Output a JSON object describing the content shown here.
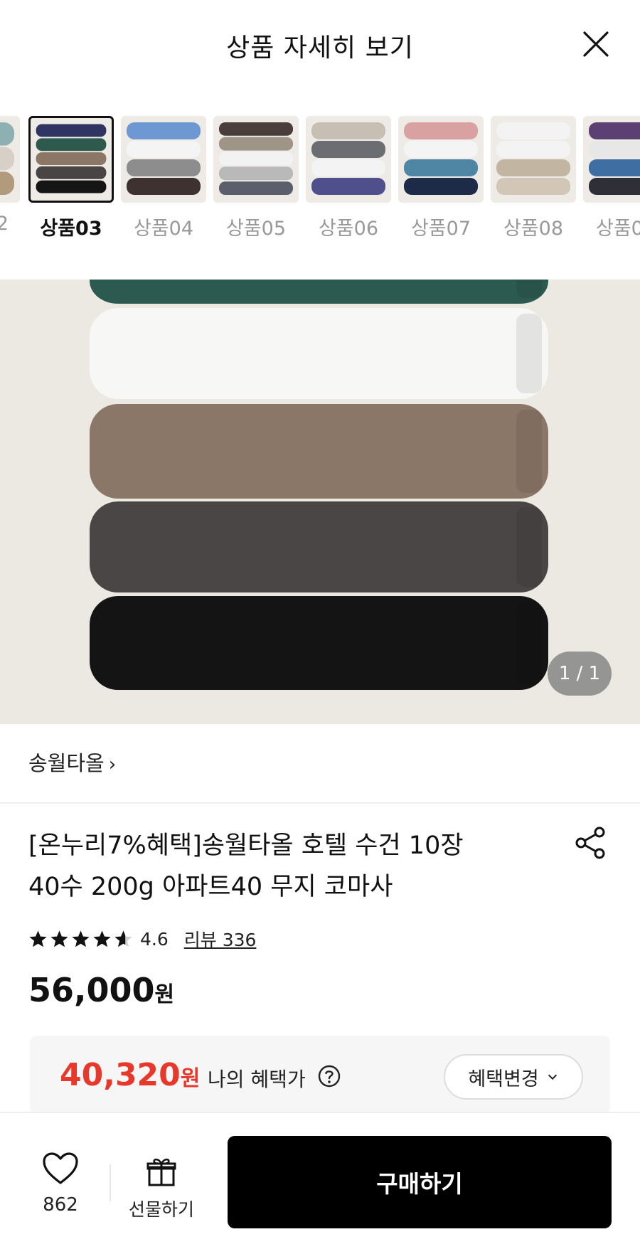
{
  "header": {
    "title": "상품 자세히 보기",
    "close_icon": "close-icon"
  },
  "thumbnails": [
    {
      "label": "2",
      "selected": false
    },
    {
      "label": "상품03",
      "selected": true,
      "colors": [
        "#2f3463",
        "#2e5a4d",
        "#8c7666",
        "#4a4545",
        "#151515"
      ]
    },
    {
      "label": "상품04",
      "selected": false,
      "colors": [
        "#6e98d2",
        "#f4f4f4",
        "#8d8d8d",
        "#3e3231"
      ]
    },
    {
      "label": "상품05",
      "selected": false,
      "colors": [
        "#4a3e3a",
        "#9e9488",
        "#f2f2f2",
        "#b9b9b9",
        "#5a5f6b"
      ]
    },
    {
      "label": "상품06",
      "selected": false,
      "colors": [
        "#c8bfb4",
        "#6c6d73",
        "#f3f3f3",
        "#4f4f8c"
      ]
    },
    {
      "label": "상품07",
      "selected": false,
      "colors": [
        "#d9a1a1",
        "#f4f4f4",
        "#4f86a3",
        "#1e2b48"
      ]
    },
    {
      "label": "상품08",
      "selected": false,
      "colors": [
        "#f3f3f3",
        "#f3f3f3",
        "#c2b5a2",
        "#d2c7b6"
      ]
    },
    {
      "label": "상품0",
      "selected": false,
      "colors": [
        "#5c3f73",
        "#e7e7e7",
        "#3f6ea3",
        "#2f2f38"
      ]
    }
  ],
  "main_image": {
    "page_indicator": "1 / 1",
    "towel_colors": [
      "#2d5a50",
      "#f7f7f5",
      "#8b7768",
      "#4b4646",
      "#141414"
    ]
  },
  "brand": {
    "name": "송월타올",
    "chevron": "›"
  },
  "product": {
    "title_line1": "[온누리7%혜택]송월타올 호텔 수건 10장",
    "title_line2": "40수 200g 아파트40 무지 코마사",
    "share_icon": "share-icon"
  },
  "rating": {
    "stars": 4.6,
    "value": "4.6",
    "review_label": "리뷰 336"
  },
  "price": {
    "amount": "56,000",
    "unit": "원"
  },
  "benefit": {
    "amount": "40,320",
    "unit": "원",
    "label": "나의 혜택가",
    "help_icon": "help-circle-icon",
    "change_label": "혜택변경",
    "chevron": "⌄"
  },
  "bottom_bar": {
    "like_count": "862",
    "gift_label": "선물하기",
    "buy_label": "구매하기"
  },
  "colors": {
    "accent_red": "#e8382c",
    "buy_button": "#000000"
  }
}
